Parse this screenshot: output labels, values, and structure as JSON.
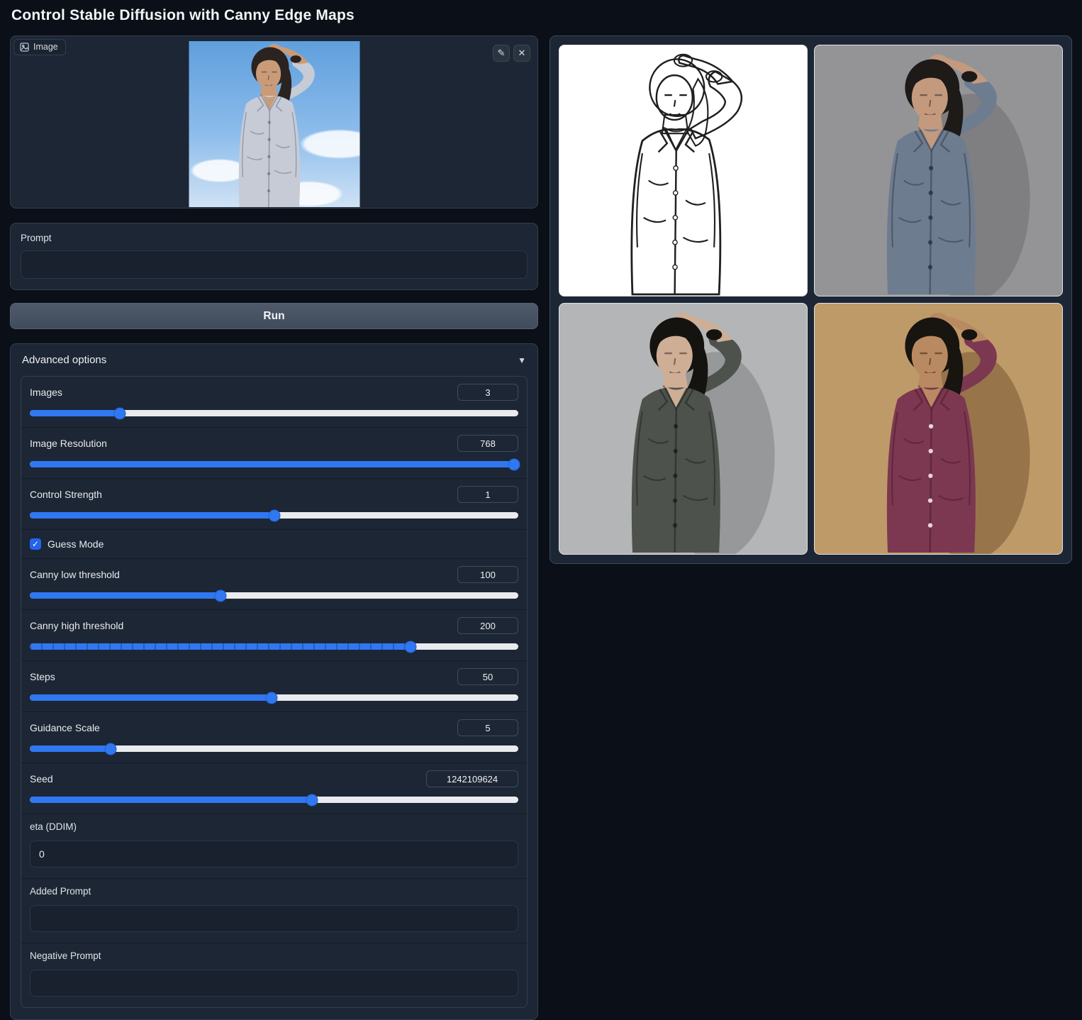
{
  "page": {
    "title": "Control Stable Diffusion with Canny Edge Maps"
  },
  "icons": {
    "edit": "✎",
    "clear": "✕",
    "collapse": "▼",
    "check": "✓"
  },
  "input_image": {
    "label": "Image",
    "palette": {
      "sky_top": "#5f9fdd",
      "sky_mid": "#8cbceb",
      "sky_bottom": "#cfe2f5",
      "cloud": "rgba(255,255,255,0.85)",
      "skin": "#c99b78",
      "hair": "#2a2320",
      "shirt": "#c6cbd6",
      "line": "none",
      "detail": "rgba(60,70,90,0.35)",
      "face_line": "rgba(80,50,35,0.55)",
      "btn": "rgba(70,75,90,0.45)",
      "shadow": "none"
    }
  },
  "prompt": {
    "label": "Prompt",
    "value": "",
    "placeholder": ""
  },
  "run_button": {
    "label": "Run"
  },
  "advanced": {
    "header": "Advanced options",
    "rows": {
      "images": {
        "label": "Images",
        "value": "3",
        "percent": 18.5
      },
      "resolution": {
        "label": "Image Resolution",
        "value": "768",
        "percent": 99.2
      },
      "strength": {
        "label": "Control Strength",
        "value": "1",
        "percent": 50
      },
      "guess": {
        "label": "Guess Mode",
        "checked": true
      },
      "canny_low": {
        "label": "Canny low threshold",
        "value": "100",
        "percent": 39
      },
      "canny_high": {
        "label": "Canny high threshold",
        "value": "200",
        "percent": 78
      },
      "steps": {
        "label": "Steps",
        "value": "50",
        "percent": 49.5
      },
      "guidance": {
        "label": "Guidance Scale",
        "value": "5",
        "percent": 16.5
      },
      "seed": {
        "label": "Seed",
        "value": "1242109624",
        "percent": 57.8
      },
      "eta": {
        "label": "eta (DDIM)",
        "value": "0"
      },
      "added_prompt": {
        "label": "Added Prompt",
        "value": ""
      },
      "negative_prompt": {
        "label": "Negative Prompt",
        "value": ""
      }
    }
  },
  "gallery": {
    "items": [
      {
        "name": "canny-edge-map",
        "palette": {
          "bg": "#ffffff",
          "skin": "none",
          "hair": "none",
          "shirt": "none",
          "line": "#1f1f1f",
          "detail": "#1f1f1f",
          "face_line": "#1f1f1f",
          "btn": "#ffffff",
          "shadow": "none"
        }
      },
      {
        "name": "generated-gray-blue-shirt",
        "palette": {
          "bg": "#949497",
          "skin": "#c49a7e",
          "hair": "#1d1a18",
          "shirt": "#6e7c90",
          "line": "none",
          "detail": "rgba(20,25,35,0.35)",
          "face_line": "rgba(60,40,30,0.55)",
          "btn": "rgba(25,30,40,0.6)",
          "shadow": "rgba(0,0,0,0.14)"
        }
      },
      {
        "name": "generated-charcoal-shirt",
        "palette": {
          "bg": "#b4b5b7",
          "skin": "#cfae96",
          "hair": "#15130f",
          "shirt": "#4e524c",
          "line": "none",
          "detail": "rgba(15,18,15,0.4)",
          "face_line": "rgba(60,40,30,0.55)",
          "btn": "rgba(10,12,10,0.55)",
          "shadow": "rgba(0,0,0,0.16)"
        }
      },
      {
        "name": "generated-maroon-shirt",
        "palette": {
          "bg": "#bf9a69",
          "skin": "#b98a62",
          "hair": "#181410",
          "shirt": "#7c3850",
          "line": "none",
          "detail": "rgba(60,15,35,0.4)",
          "face_line": "rgba(70,40,25,0.6)",
          "btn": "#ecd2da",
          "shadow": "rgba(80,45,20,0.35)"
        }
      }
    ]
  },
  "colors": {
    "accent_blue": "#3077f2",
    "checkbox_blue": "#2563eb",
    "panel": "#1d2634",
    "page_bg": "#0b0f17",
    "track": "#e9ebee"
  }
}
